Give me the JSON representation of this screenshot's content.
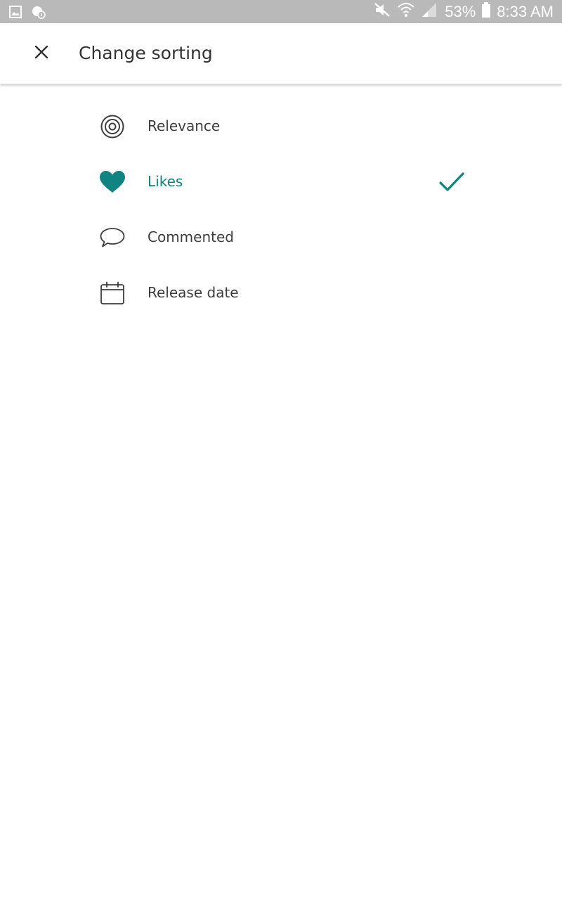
{
  "status_bar": {
    "battery_percent": "53%",
    "time": "8:33 AM",
    "icons": [
      "gallery-icon",
      "lock-info-icon",
      "mute-icon",
      "wifi-icon",
      "signal-icon",
      "battery-icon"
    ]
  },
  "header": {
    "title": "Change sorting",
    "close_icon": "close-icon"
  },
  "sort_options": [
    {
      "label": "Relevance",
      "icon": "target-icon",
      "selected": false
    },
    {
      "label": "Likes",
      "icon": "heart-icon",
      "selected": true
    },
    {
      "label": "Commented",
      "icon": "comment-icon",
      "selected": false
    },
    {
      "label": "Release date",
      "icon": "calendar-icon",
      "selected": false
    }
  ],
  "colors": {
    "accent": "#0f8480",
    "status_bar": "#b9b9b9",
    "text": "#3d3d3d"
  }
}
